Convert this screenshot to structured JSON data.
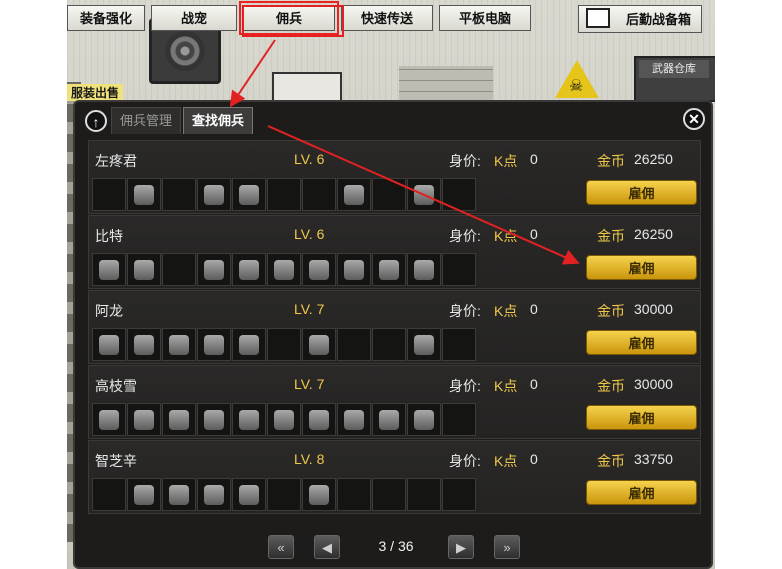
{
  "topnav": {
    "items": [
      "装备强化",
      "战宠",
      "佣兵",
      "快速传送",
      "平板电脑"
    ],
    "logistics": "后勤战备箱"
  },
  "background": {
    "arsenal_label": "武器仓库",
    "shop_label": "",
    "shop_label_visible": "服装出售"
  },
  "panel": {
    "tabs": [
      "佣兵管理",
      "查找佣兵"
    ],
    "active_tab": "查找佣兵",
    "labels": {
      "worth": "身价:",
      "k_point": "K点",
      "gold": "金币",
      "hire": "雇佣"
    },
    "mercenaries": [
      {
        "name": "左疼君",
        "level": "LV. 6",
        "worth": "0",
        "gold": "26250"
      },
      {
        "name": "比特",
        "level": "LV. 6",
        "worth": "0",
        "gold": "26250"
      },
      {
        "name": "阿龙",
        "level": "LV. 7",
        "worth": "0",
        "gold": "30000"
      },
      {
        "name": "高枝雪",
        "level": "LV. 7",
        "worth": "0",
        "gold": "30000"
      },
      {
        "name": "智芝辛",
        "level": "LV. 8",
        "worth": "0",
        "gold": "33750"
      }
    ]
  },
  "pager": {
    "page_info": "3 / 36",
    "first": "«",
    "prev": "◀",
    "next": "▶",
    "last": "»"
  },
  "colors": {
    "accent_gold": "#f0c84a",
    "annotation_red": "#e22222"
  }
}
